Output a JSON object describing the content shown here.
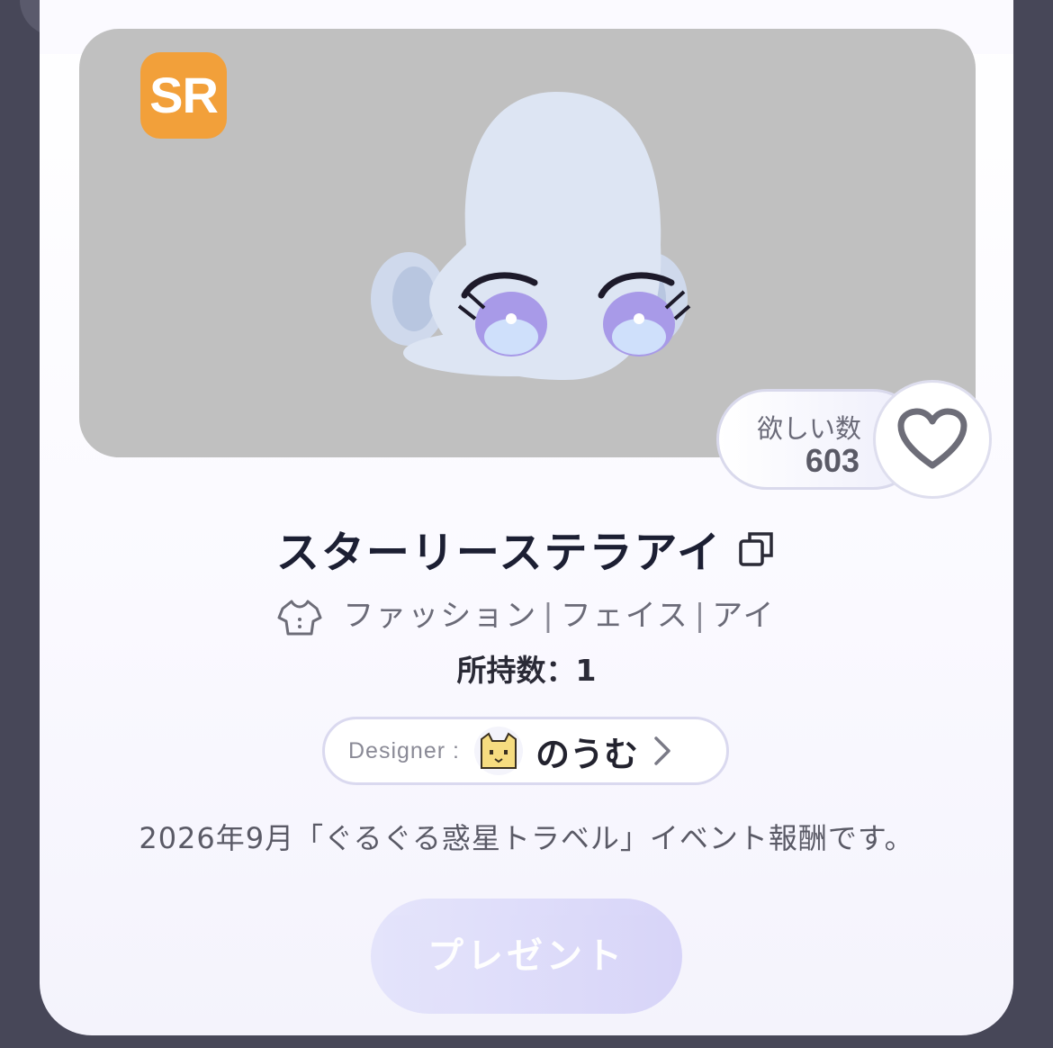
{
  "item": {
    "rarity": "SR",
    "title": "スターリーステラアイ",
    "categories": [
      "ファッション",
      "フェイス",
      "アイ"
    ],
    "owned": "所持数：1",
    "description": "2026年9月「ぐるぐる惑星トラベル」イベント報酬です。"
  },
  "wishlist": {
    "label": "欲しい数",
    "count": "603"
  },
  "designer": {
    "label": "Designer :",
    "name": "のうむ"
  },
  "actions": {
    "present_label": "プレゼント"
  },
  "icons": {
    "copy": "copy-icon",
    "heart": "heart-icon",
    "category": "shirt-icon",
    "chevron": "chevron-right-icon",
    "avatar": "cat-avatar-icon"
  },
  "colors": {
    "rarity_badge": "#f2a03a",
    "preview_bg": "#c0c0c0",
    "present_button": "#d6d3f8",
    "page_bg": "#474758"
  }
}
